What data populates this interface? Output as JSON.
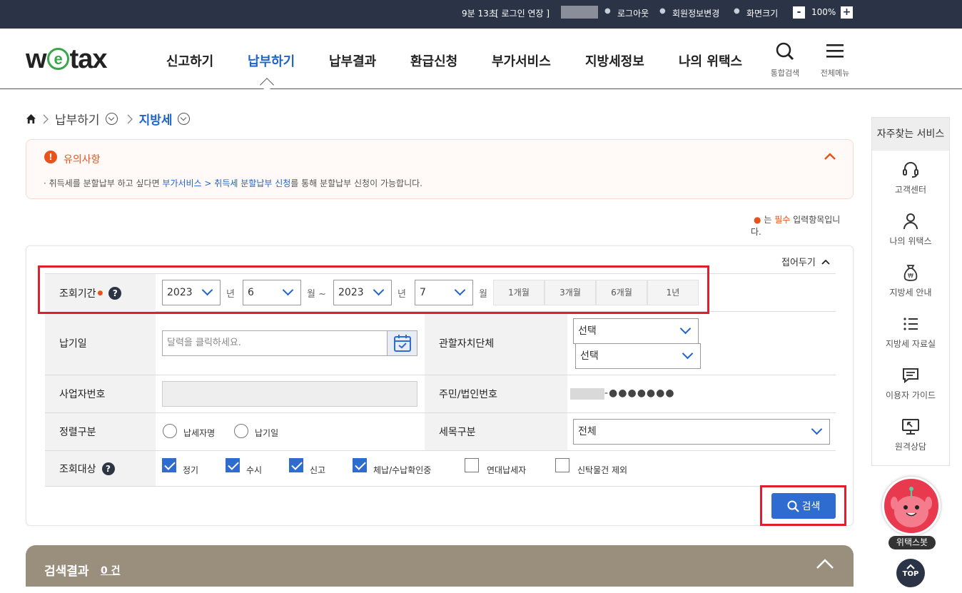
{
  "topbar": {
    "timer": "9분 13초",
    "extend": "[ 로그인 연장 ]",
    "logout": "로그아웃",
    "member_edit": "회원정보변경",
    "screen_size": "화면크기",
    "minus": "-",
    "zoom": "100%",
    "plus": "+"
  },
  "header": {
    "logo_pre": "w",
    "logo_e": "e",
    "logo_post": "tax",
    "nav": [
      "신고하기",
      "납부하기",
      "납부결과",
      "환급신청",
      "부가서비스",
      "지방세정보",
      "나의 위택스"
    ],
    "search_label": "통합검색",
    "menu_label": "전체메뉴"
  },
  "breadcrumb": {
    "level1": "납부하기",
    "level2": "지방세"
  },
  "notice": {
    "title": "유의사항",
    "text_pre": "취득세를 분할납부 하고 싶다면 ",
    "link": "부가서비스 > 취득세 분할납부 신청",
    "text_post": "를 통해 분할납부 신청이 가능합니다."
  },
  "required_note": {
    "pre": "는",
    "word": "필수",
    "post": "입력항목입니",
    "post2": "다."
  },
  "form": {
    "collapse_label": "접어두기",
    "period": {
      "label": "조회기간",
      "start_year": "2023",
      "start_month": "6",
      "end_year": "2023",
      "end_month": "7",
      "year_unit": "년",
      "month_unit": "월",
      "tilde": "~",
      "buttons": [
        "1개월",
        "3개월",
        "6개월",
        "1년"
      ]
    },
    "due_date": {
      "label": "납기일",
      "placeholder": "달력을 클릭하세요."
    },
    "authority": {
      "label": "관할자치단체",
      "select1": "선택",
      "select2": "선택"
    },
    "business_no": {
      "label": "사업자번호",
      "value": ""
    },
    "resident_no": {
      "label": "주민/법인번호",
      "masked": "-●●●●●●●"
    },
    "sort": {
      "label": "정렬구분",
      "options": [
        "납세자명",
        "납기일"
      ]
    },
    "tax_item": {
      "label": "세목구분",
      "value": "전체"
    },
    "target": {
      "label": "조회대상",
      "options": [
        {
          "label": "정기",
          "checked": true
        },
        {
          "label": "수시",
          "checked": true
        },
        {
          "label": "신고",
          "checked": true
        },
        {
          "label": "체납/수납확인중",
          "checked": true
        },
        {
          "label": "연대납세자",
          "checked": false
        },
        {
          "label": "신탁물건 제외",
          "checked": false
        }
      ]
    },
    "search_button": "검색"
  },
  "results": {
    "title": "검색결과",
    "count": "0 건"
  },
  "sidebar": {
    "title": "자주찾는 서비스",
    "items": [
      "고객센터",
      "나의 위택스",
      "지방세 안내",
      "지방세 자료실",
      "이용자 가이드",
      "원격상담"
    ]
  },
  "chatbot": {
    "label": "위택스봇"
  },
  "top_button": "TOP"
}
